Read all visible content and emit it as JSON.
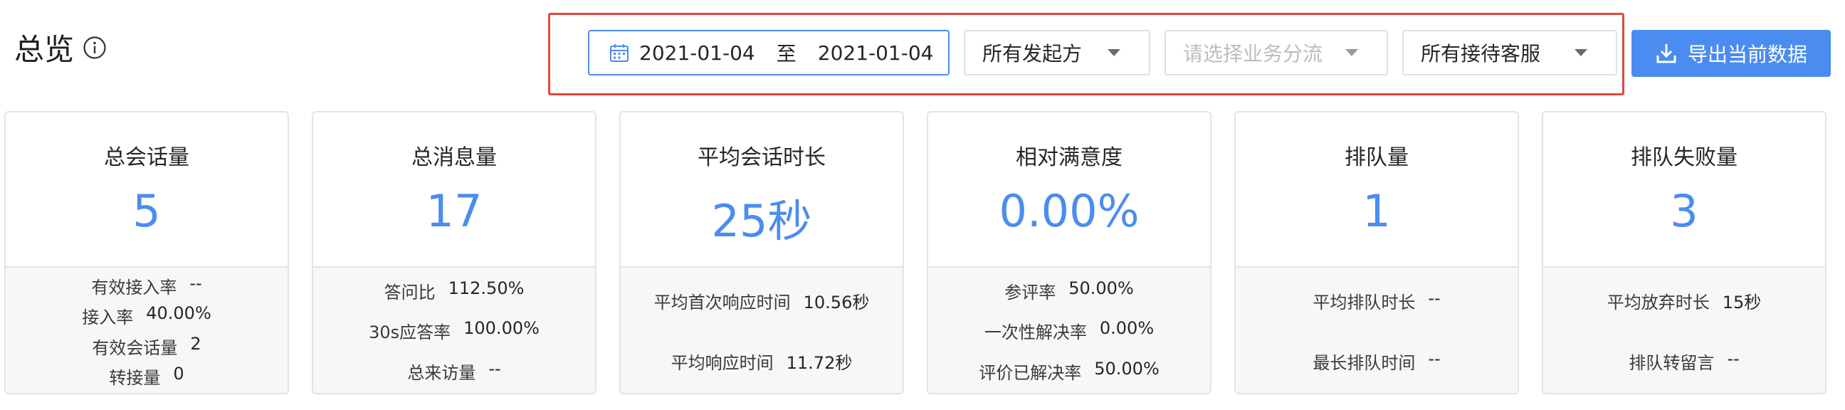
{
  "header": {
    "title": "总览",
    "info_icon": "info-circle-icon"
  },
  "filters": {
    "date_start": "2021-01-04",
    "date_separator": "至",
    "date_end": "2021-01-04",
    "initiator": "所有发起方",
    "business_flow_placeholder": "请选择业务分流",
    "agent": "所有接待客服",
    "export_label": "导出当前数据"
  },
  "colors": {
    "accent": "#4b8cf0",
    "highlight_border": "#e2463f"
  },
  "cards": [
    {
      "title": "总会话量",
      "value": "5",
      "stats": [
        {
          "label": "有效接入率",
          "value": "--"
        },
        {
          "label": "接入率",
          "value": "40.00%"
        },
        {
          "label": "有效会话量",
          "value": "2"
        },
        {
          "label": "转接量",
          "value": "0"
        }
      ]
    },
    {
      "title": "总消息量",
      "value": "17",
      "stats": [
        {
          "label": "答问比",
          "value": "112.50%"
        },
        {
          "label": "30s应答率",
          "value": "100.00%"
        },
        {
          "label": "总来访量",
          "value": "--"
        }
      ]
    },
    {
      "title": "平均会话时长",
      "value": "25秒",
      "stats": [
        {
          "label": "平均首次响应时间",
          "value": "10.56秒"
        },
        {
          "label": "平均响应时间",
          "value": "11.72秒"
        }
      ]
    },
    {
      "title": "相对满意度",
      "value": "0.00%",
      "stats": [
        {
          "label": "参评率",
          "value": "50.00%"
        },
        {
          "label": "一次性解决率",
          "value": "0.00%"
        },
        {
          "label": "评价已解决率",
          "value": "50.00%"
        }
      ]
    },
    {
      "title": "排队量",
      "value": "1",
      "stats": [
        {
          "label": "平均排队时长",
          "value": "--"
        },
        {
          "label": "最长排队时间",
          "value": "--"
        }
      ]
    },
    {
      "title": "排队失败量",
      "value": "3",
      "stats": [
        {
          "label": "平均放弃时长",
          "value": "15秒"
        },
        {
          "label": "排队转留言",
          "value": "--"
        }
      ]
    }
  ]
}
